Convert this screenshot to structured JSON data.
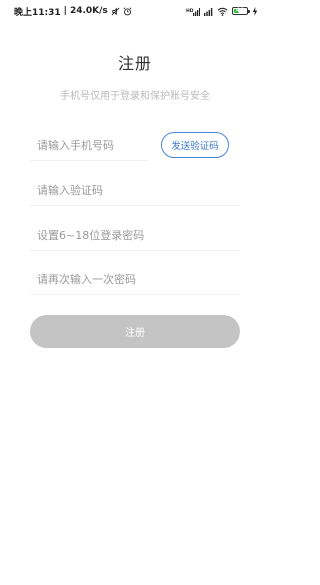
{
  "status_bar": {
    "time_label": "晚上11:31",
    "network_speed": "24.0K/s",
    "battery_level": "40",
    "battery_fraction": 0.4,
    "battery_color": "#2ec23a",
    "icons": [
      "mute-icon",
      "alarm-icon",
      "signal-hd-icon",
      "signal-icon",
      "wifi-icon",
      "battery-icon",
      "charging-icon"
    ]
  },
  "header": {
    "title": "注册",
    "subtitle": "手机号仅用于登录和保护账号安全"
  },
  "form": {
    "phone": {
      "placeholder": "请输入手机号码",
      "value": ""
    },
    "send_code_label": "发送验证码",
    "code": {
      "placeholder": "请输入验证码",
      "value": ""
    },
    "password": {
      "placeholder": "设置6~18位登录密码",
      "value": ""
    },
    "confirm_password": {
      "placeholder": "请再次输入一次密码",
      "value": ""
    },
    "submit_label": "注册"
  },
  "colors": {
    "accent": "#3a76cc",
    "disabled_button": "#c4c4c4",
    "placeholder": "#9a9a9a"
  }
}
